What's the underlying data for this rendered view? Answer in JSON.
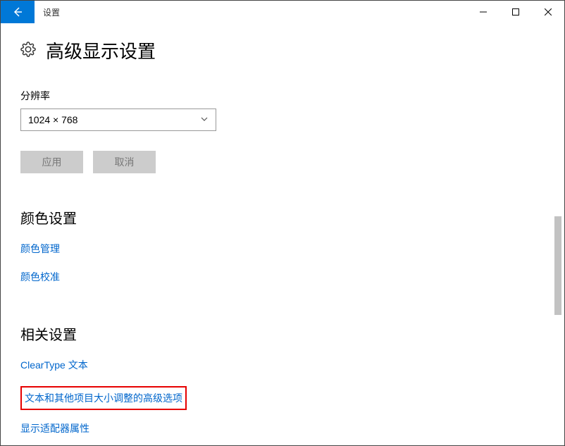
{
  "window": {
    "title": "设置"
  },
  "page": {
    "title": "高级显示设置"
  },
  "resolution": {
    "label": "分辨率",
    "value": "1024 × 768"
  },
  "buttons": {
    "apply": "应用",
    "cancel": "取消"
  },
  "color_section": {
    "title": "颜色设置",
    "color_management": "颜色管理",
    "color_calibration": "颜色校准"
  },
  "related_section": {
    "title": "相关设置",
    "cleartype": "ClearType 文本",
    "advanced_text_sizing": "文本和其他项目大小调整的高级选项",
    "display_adapter": "显示适配器属性"
  }
}
